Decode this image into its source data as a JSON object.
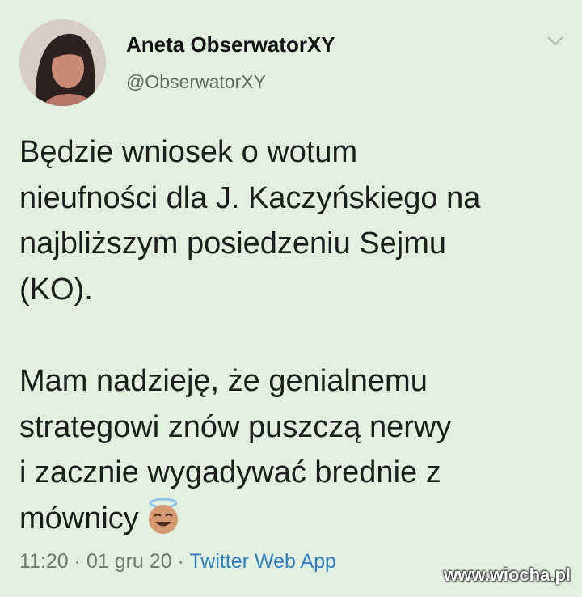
{
  "tweet": {
    "author_name": "Aneta ObserwatorXY",
    "author_handle": "@ObserwatorXY",
    "paragraph_1": "Będzie wniosek o wotum\nnieufności dla J. Kaczyńskiego na\nnajbliższym posiedzeniu Sejmu\n(KO).",
    "paragraph_2": "Mam nadzieję, że genialnemu\nstrategowi znów puszczą nerwy\ni zacznie wygadywać brednie z\nmównicy",
    "emoji_icon": "smiling-face-with-halo-icon",
    "time": "11:20",
    "separator": "·",
    "date": "01 gru 20",
    "source": "Twitter Web App"
  },
  "watermark": "www.wiocha.pl",
  "colors": {
    "background": "#e3efdf",
    "link": "#2f7fc0",
    "muted": "#6b7a6e"
  }
}
